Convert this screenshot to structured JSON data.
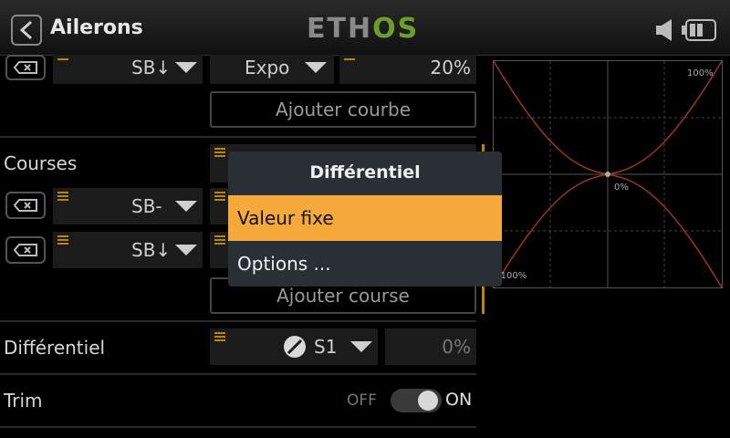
{
  "header": {
    "title": "Ailerons",
    "logo_main": "ETH",
    "logo_accent": "OS"
  },
  "top_row": {
    "switch": "SB↓",
    "curve_type": "Expo",
    "value": "20%",
    "add_curve": "Ajouter courbe"
  },
  "courses": {
    "label": "Courses",
    "rows": [
      {
        "switch": "SB-"
      },
      {
        "switch": "SB↓"
      }
    ],
    "add_course": "Ajouter course"
  },
  "differential": {
    "label": "Différentiel",
    "switch": "S1",
    "value": "0%"
  },
  "trim": {
    "label": "Trim",
    "off": "OFF",
    "on": "ON"
  },
  "graph": {
    "top_label": "100%",
    "center_label": "0%",
    "bottom_label": "-100%"
  },
  "dialog": {
    "title": "Différentiel",
    "options": [
      "Valeur fixe",
      "Options ..."
    ],
    "selected_index": 0
  },
  "colors": {
    "accent": "#f5a93a",
    "logo_green": "#6aa02a",
    "curve": "#a0341f"
  }
}
